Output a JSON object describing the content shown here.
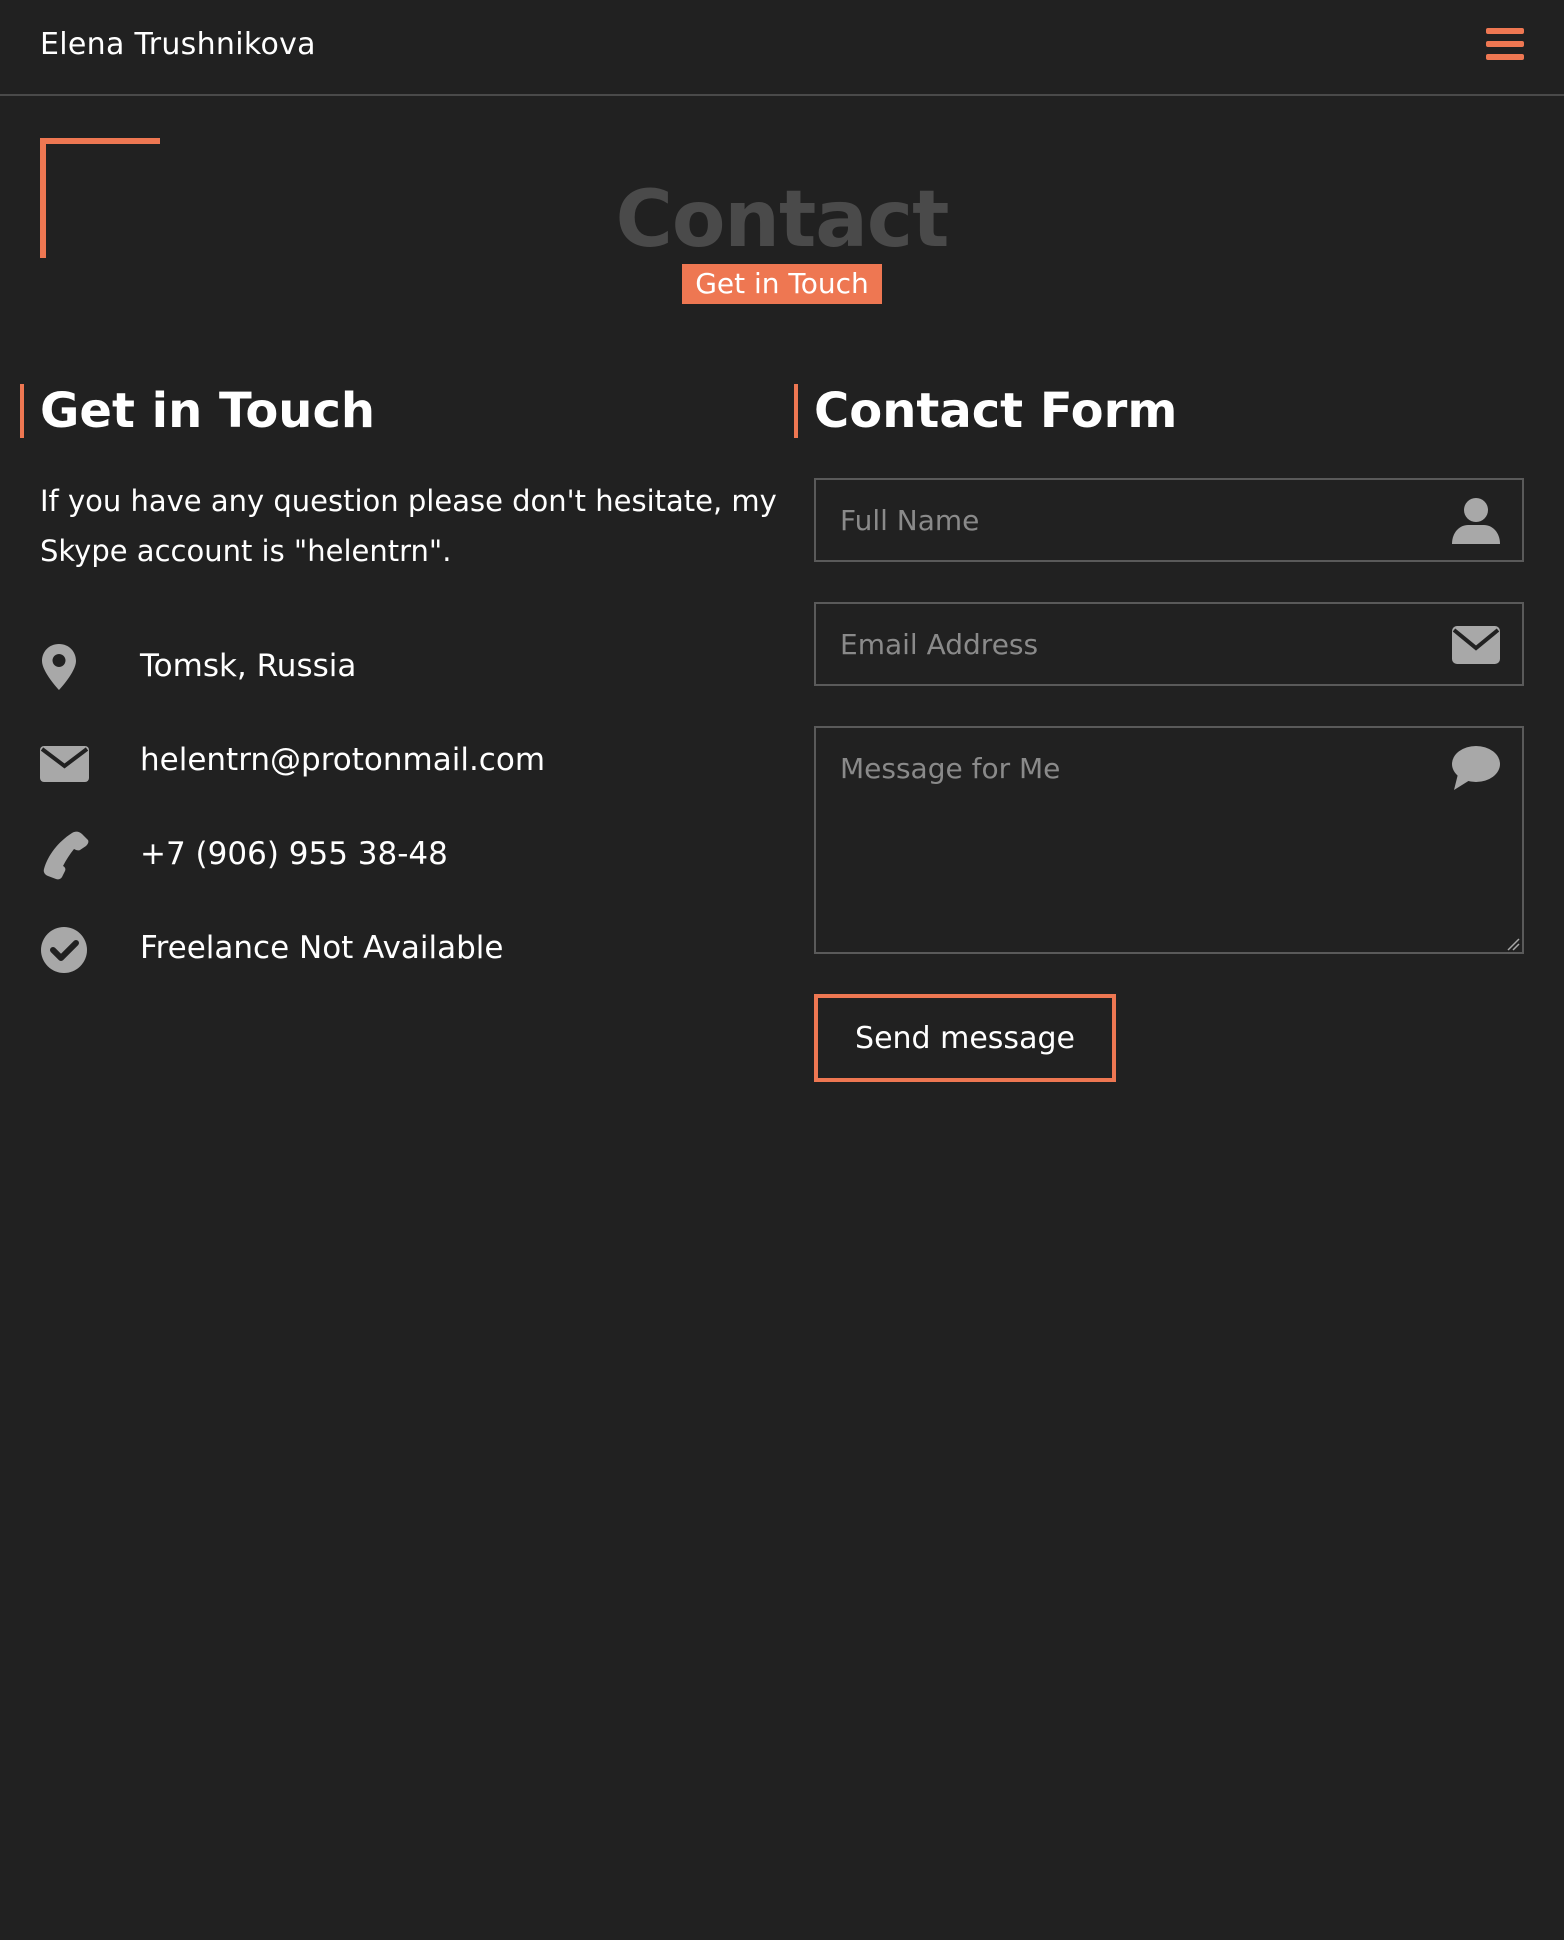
{
  "header": {
    "brand": "Elena Trushnikova",
    "menu_icon": "hamburger-menu-icon"
  },
  "section": {
    "title": "Contact",
    "badge": "Get in Touch"
  },
  "left": {
    "heading": "Get in Touch",
    "intro": "If you have any question please don't hesitate, my Skype account is \"helentrn\".",
    "items": [
      {
        "icon": "map-marker-icon",
        "text": "Tomsk, Russia"
      },
      {
        "icon": "envelope-icon",
        "text": "helentrn@protonmail.com"
      },
      {
        "icon": "phone-icon",
        "text": "+7 (906) 955 38-48"
      },
      {
        "icon": "check-circle-icon",
        "text": "Freelance Not Available"
      }
    ]
  },
  "form": {
    "heading": "Contact Form",
    "name_placeholder": "Full Name",
    "name_value": "",
    "email_placeholder": "Email Address",
    "email_value": "",
    "message_placeholder": "Message for Me",
    "message_value": "",
    "submit_label": "Send message"
  },
  "colors": {
    "background": "#212121",
    "accent": "#ee7752",
    "title_muted": "#4a4a4a",
    "icon_gray": "#a8a8a8"
  }
}
